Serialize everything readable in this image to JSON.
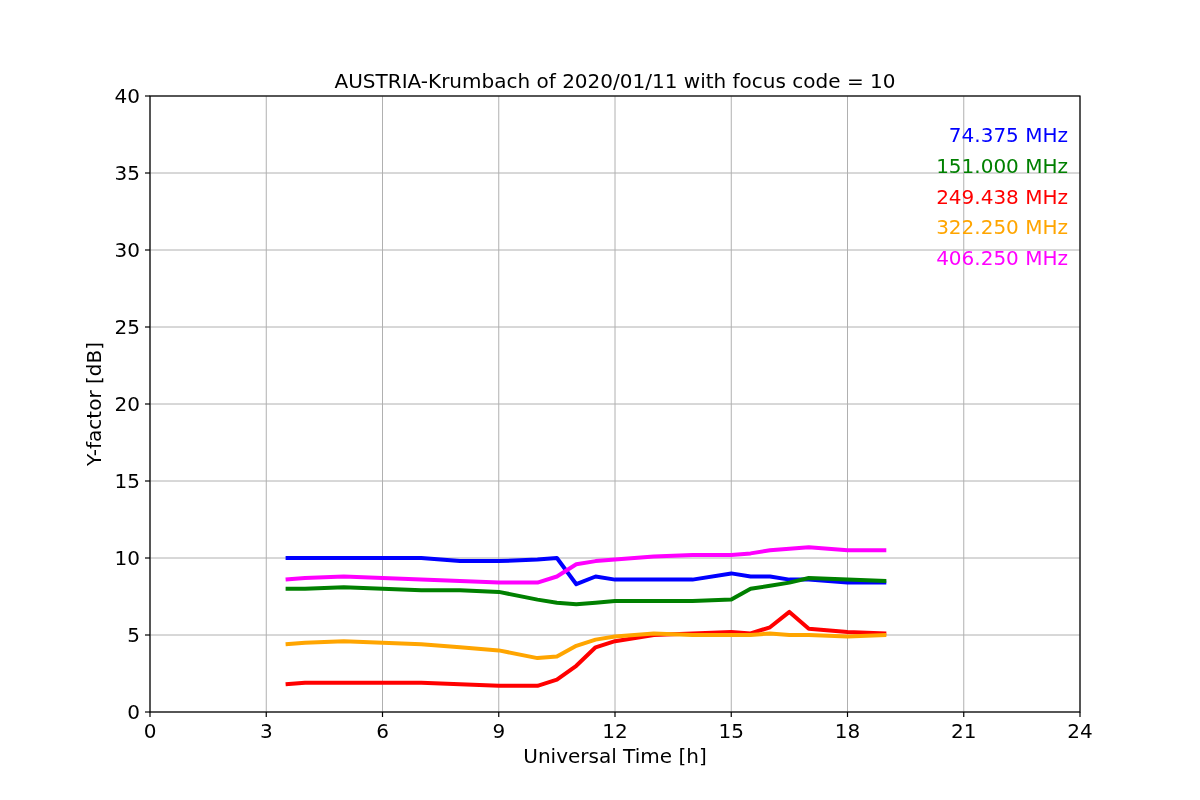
{
  "chart": {
    "chart_data": {
      "type": "line",
      "title": "AUSTRIA-Krumbach of 2020/01/11 with focus code = 10",
      "xlabel": "Universal Time [h]",
      "ylabel": "Y-factor [dB]",
      "x": [
        3.5,
        4,
        5,
        6,
        7,
        8,
        9,
        10,
        10.5,
        11,
        11.5,
        12,
        13,
        14,
        15,
        15.5,
        16,
        16.5,
        17,
        18,
        19
      ],
      "series": [
        {
          "name": "74.375 MHz",
          "color": "#0000ff",
          "values": [
            10,
            10,
            10,
            10,
            10,
            9.8,
            9.8,
            9.9,
            10,
            8.3,
            8.8,
            8.6,
            8.6,
            8.6,
            9,
            8.8,
            8.8,
            8.6,
            8.6,
            8.4,
            8.4
          ]
        },
        {
          "name": "151.000 MHz",
          "color": "#008000",
          "values": [
            8,
            8,
            8.1,
            8,
            7.9,
            7.9,
            7.8,
            7.3,
            7.1,
            7,
            7.1,
            7.2,
            7.2,
            7.2,
            7.3,
            8,
            8.2,
            8.4,
            8.7,
            8.6,
            8.5
          ]
        },
        {
          "name": "249.438 MHz",
          "color": "#ff0000",
          "values": [
            1.8,
            1.9,
            1.9,
            1.9,
            1.9,
            1.8,
            1.7,
            1.7,
            2.1,
            3,
            4.2,
            4.6,
            5,
            5.1,
            5.2,
            5.1,
            5.5,
            6.5,
            5.4,
            5.2,
            5.1
          ]
        },
        {
          "name": "322.250 MHz",
          "color": "#ffa500",
          "values": [
            4.4,
            4.5,
            4.6,
            4.5,
            4.4,
            4.2,
            4,
            3.5,
            3.6,
            4.3,
            4.7,
            4.9,
            5.1,
            5,
            5,
            5,
            5.1,
            5,
            5,
            4.9,
            5
          ]
        },
        {
          "name": "406.250 MHz",
          "color": "#ff00ff",
          "values": [
            8.6,
            8.7,
            8.8,
            8.7,
            8.6,
            8.5,
            8.4,
            8.4,
            8.8,
            9.6,
            9.8,
            9.9,
            10.1,
            10.2,
            10.2,
            10.3,
            10.5,
            10.6,
            10.7,
            10.5,
            10.5
          ]
        }
      ],
      "xlim": [
        0,
        24
      ],
      "ylim": [
        0,
        40
      ],
      "xticks": [
        0,
        3,
        6,
        9,
        12,
        15,
        18,
        21,
        24
      ],
      "yticks": [
        0,
        5,
        10,
        15,
        20,
        25,
        30,
        35,
        40
      ],
      "grid": true
    }
  }
}
